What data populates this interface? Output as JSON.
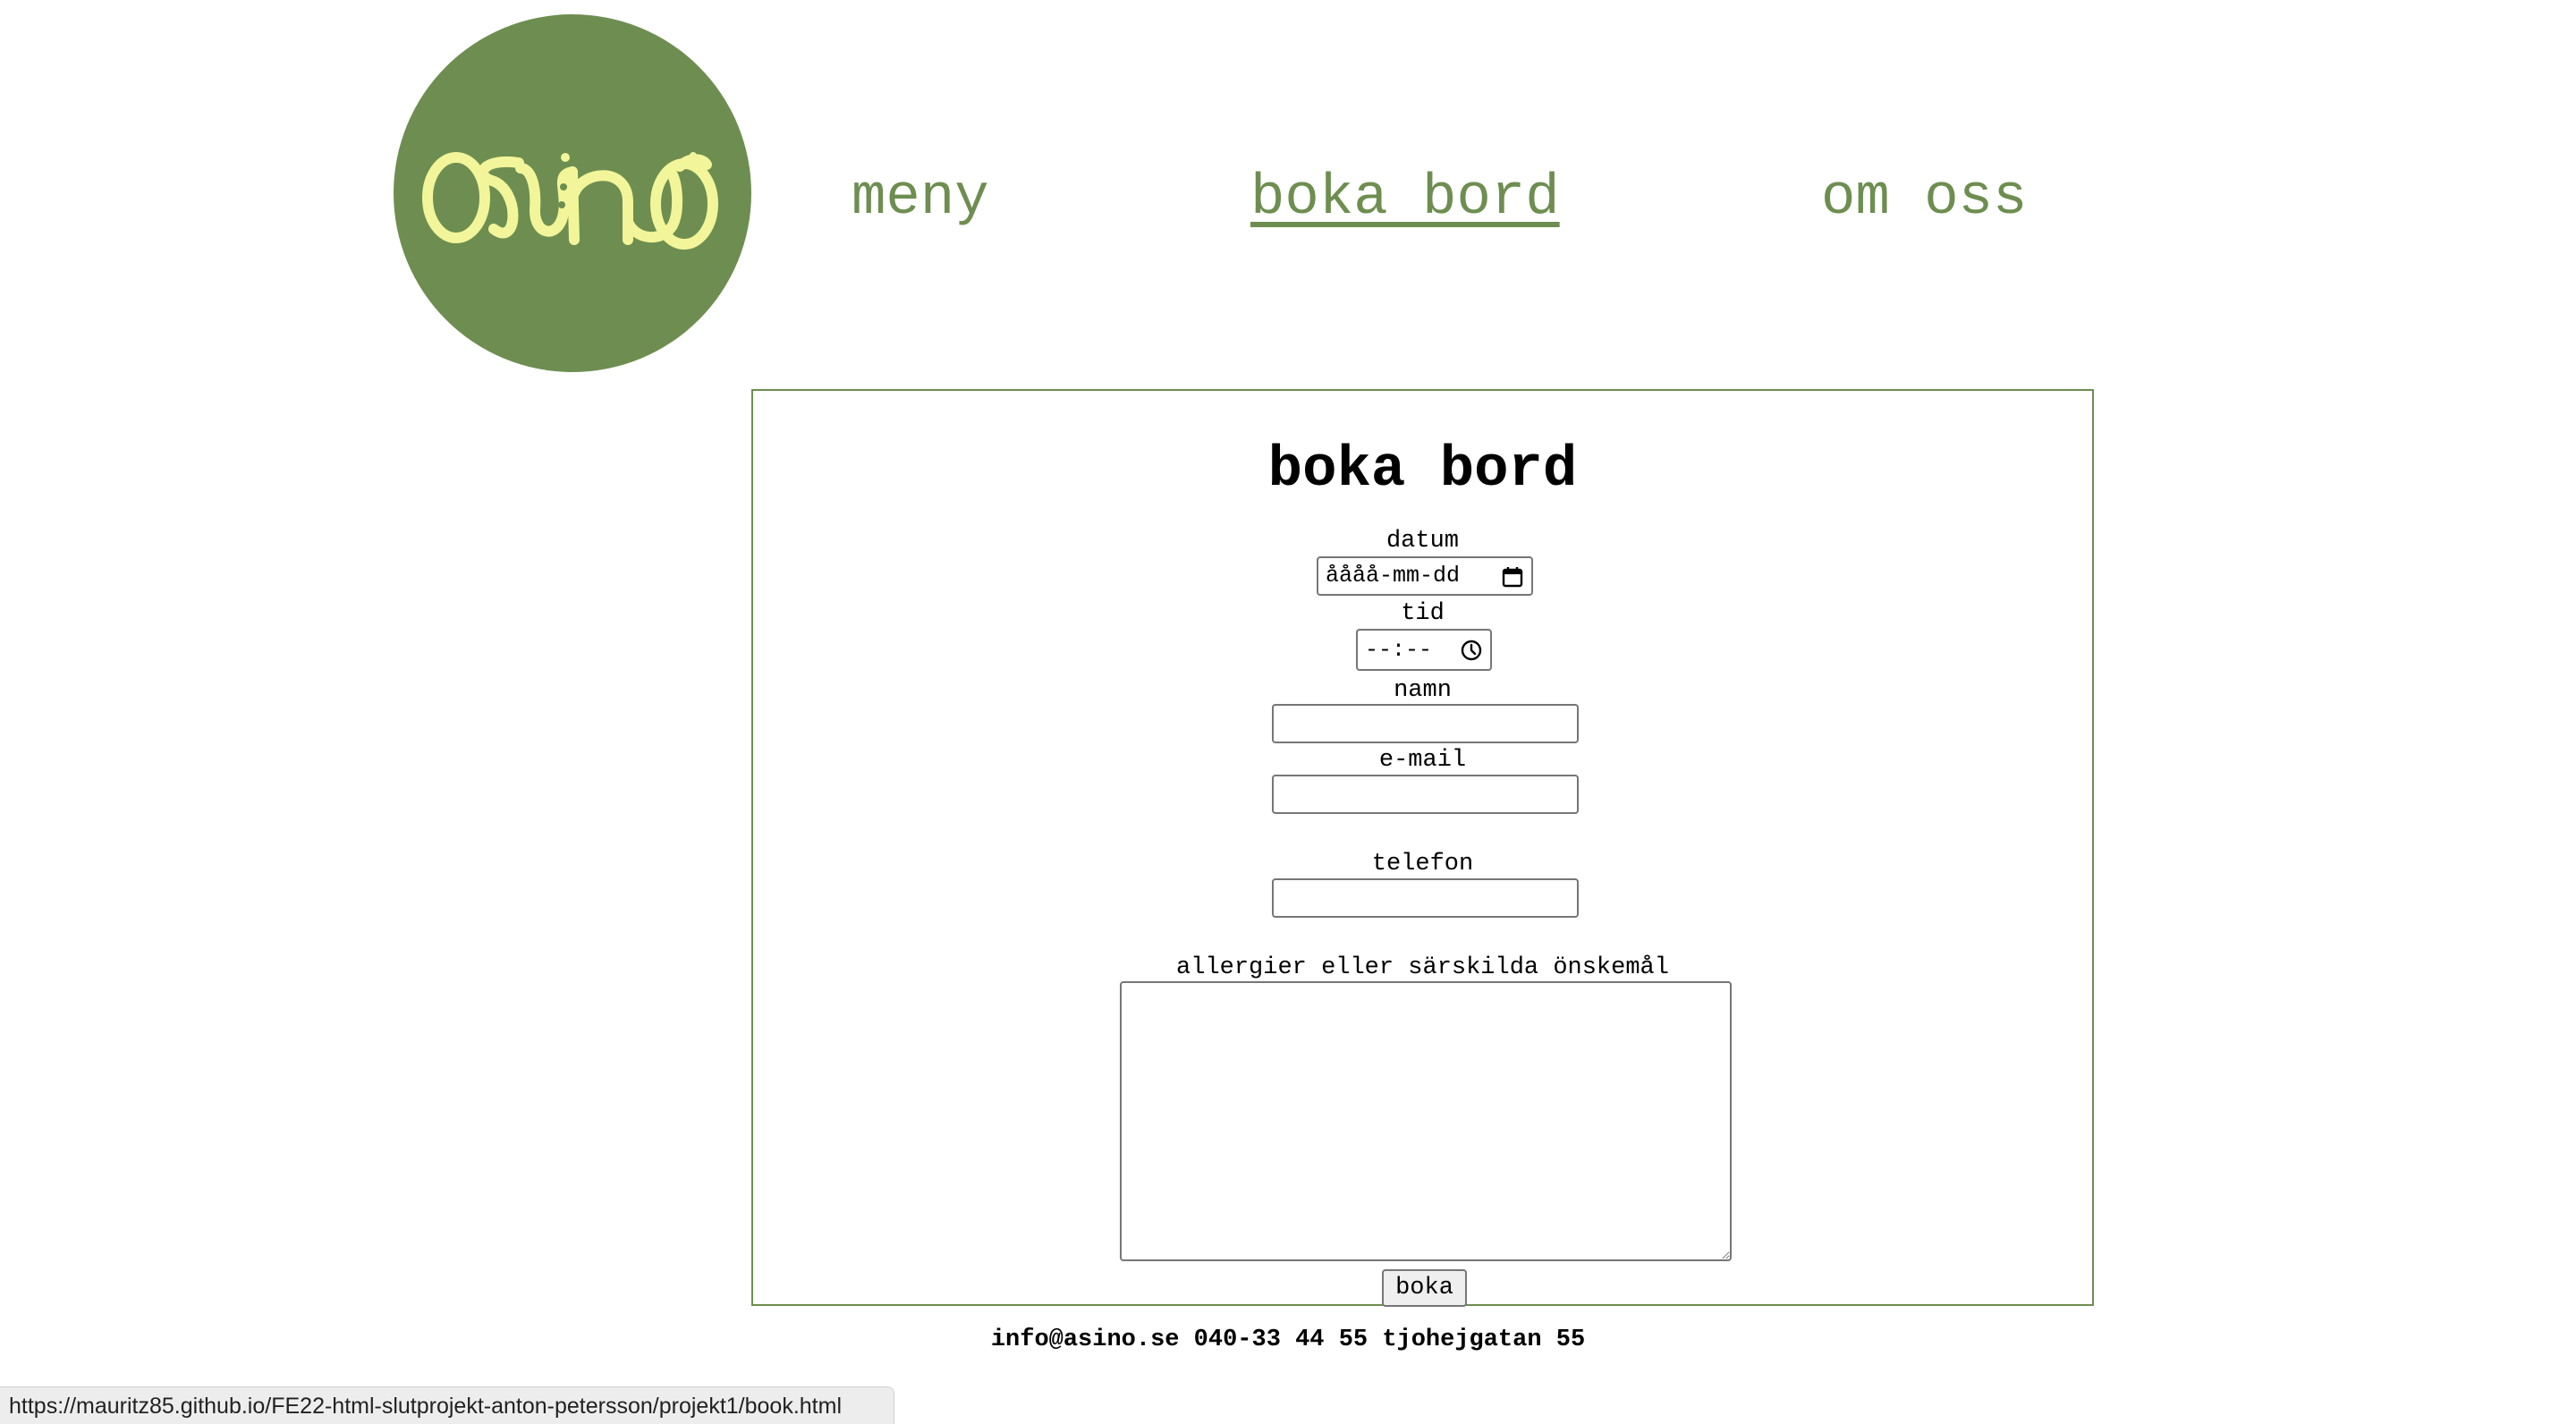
{
  "header": {
    "logo_text": "asino",
    "nav": [
      {
        "label": "meny"
      },
      {
        "label": "boka bord"
      },
      {
        "label": "om oss"
      }
    ]
  },
  "booking": {
    "title": "boka bord",
    "fields": {
      "datum": {
        "label": "datum",
        "placeholder": "åååå-mm-dd"
      },
      "tid": {
        "label": "tid",
        "placeholder": "--:--"
      },
      "namn": {
        "label": "namn",
        "value": ""
      },
      "email": {
        "label": "e-mail",
        "value": ""
      },
      "telefon": {
        "label": "telefon",
        "value": ""
      },
      "allergier": {
        "label": "allergier eller särskilda önskemål",
        "value": ""
      }
    },
    "submit_label": "boka"
  },
  "footer": {
    "contact": "info@asino.se 040-33 44 55 tjohejgatan 55"
  },
  "statusbar": {
    "url": "https://mauritz85.github.io/FE22-html-slutprojekt-anton-petersson/projekt1/book.html"
  },
  "colors": {
    "brand_green": "#6d8e50",
    "logo_yellow": "#f2f59a"
  }
}
